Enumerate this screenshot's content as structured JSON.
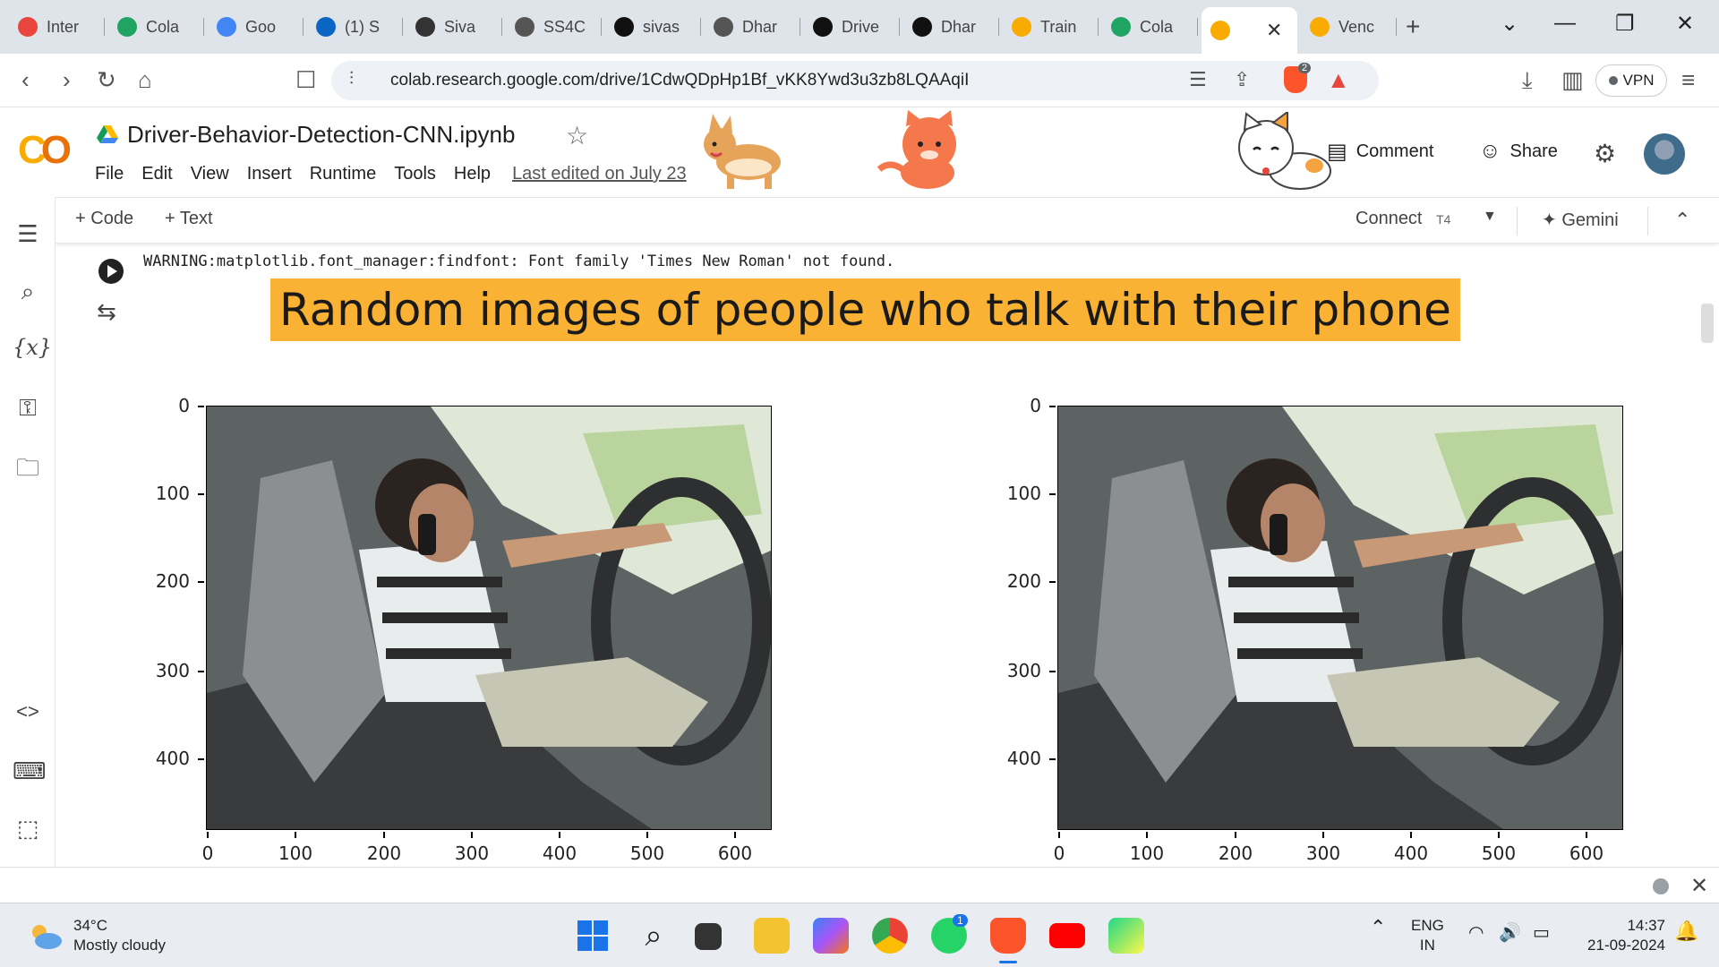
{
  "browser": {
    "tabs": [
      {
        "label": "Inter",
        "icon": "wifi-signal-icon",
        "color": "#e8453c"
      },
      {
        "label": "Cola",
        "icon": "google-drive-icon",
        "color": "#1fa463"
      },
      {
        "label": "Goo",
        "icon": "google-cloud-icon",
        "color": "#4285f4"
      },
      {
        "label": "(1) S",
        "icon": "linkedin-icon",
        "color": "#0a66c2"
      },
      {
        "label": "Siva",
        "icon": "profile-photo-icon",
        "color": "#333333"
      },
      {
        "label": "SS4C",
        "icon": "globe-icon",
        "color": "#555555"
      },
      {
        "label": "sivas",
        "icon": "github-icon",
        "color": "#111111"
      },
      {
        "label": "Dhar",
        "icon": "globe-icon",
        "color": "#555555"
      },
      {
        "label": "Drive",
        "icon": "github-icon",
        "color": "#111111"
      },
      {
        "label": "Dhar",
        "icon": "github-icon",
        "color": "#111111"
      },
      {
        "label": "Train",
        "icon": "colab-icon",
        "color": "#f9ab00"
      },
      {
        "label": "Cola",
        "icon": "google-drive-icon",
        "color": "#1fa463"
      },
      {
        "label": "",
        "icon": "colab-icon",
        "color": "#f9ab00",
        "active": true
      },
      {
        "label": "Venc",
        "icon": "colab-icon",
        "color": "#f9ab00"
      }
    ],
    "url": "colab.research.google.com/drive/1CdwQDpHp1Bf_vKK8Ywd3u3zb8LQAAqiI",
    "vpn_label": "VPN",
    "brave_badge": "2"
  },
  "colab": {
    "notebook_title": "Driver-Behavior-Detection-CNN.ipynb",
    "menu": [
      "File",
      "Edit",
      "View",
      "Insert",
      "Runtime",
      "Tools",
      "Help"
    ],
    "last_edited": "Last edited on July 23",
    "comment_label": "Comment",
    "share_label": "Share",
    "toolbar": {
      "code_label": "Code",
      "text_label": "Text",
      "connect_label": "Connect",
      "runtime_type": "T4",
      "gemini_label": "Gemini"
    }
  },
  "output": {
    "warning": "WARNING:matplotlib.font_manager:findfont: Font family 'Times New Roman' not found.",
    "title": "Random images of people who talk with their phone"
  },
  "plots": [
    {
      "y_ticks": [
        "0",
        "100",
        "200",
        "300",
        "400"
      ],
      "x_ticks": [
        "0",
        "100",
        "200",
        "300",
        "400",
        "500",
        "600"
      ]
    },
    {
      "y_ticks": [
        "0",
        "100",
        "200",
        "300",
        "400"
      ],
      "x_ticks": [
        "0",
        "100",
        "200",
        "300",
        "400",
        "500",
        "600"
      ]
    }
  ],
  "taskbar": {
    "temperature": "34°C",
    "weather": "Mostly cloudy",
    "language_top": "ENG",
    "language_bottom": "IN",
    "time": "14:37",
    "date": "21-09-2024",
    "whatsapp_badge": "1"
  }
}
